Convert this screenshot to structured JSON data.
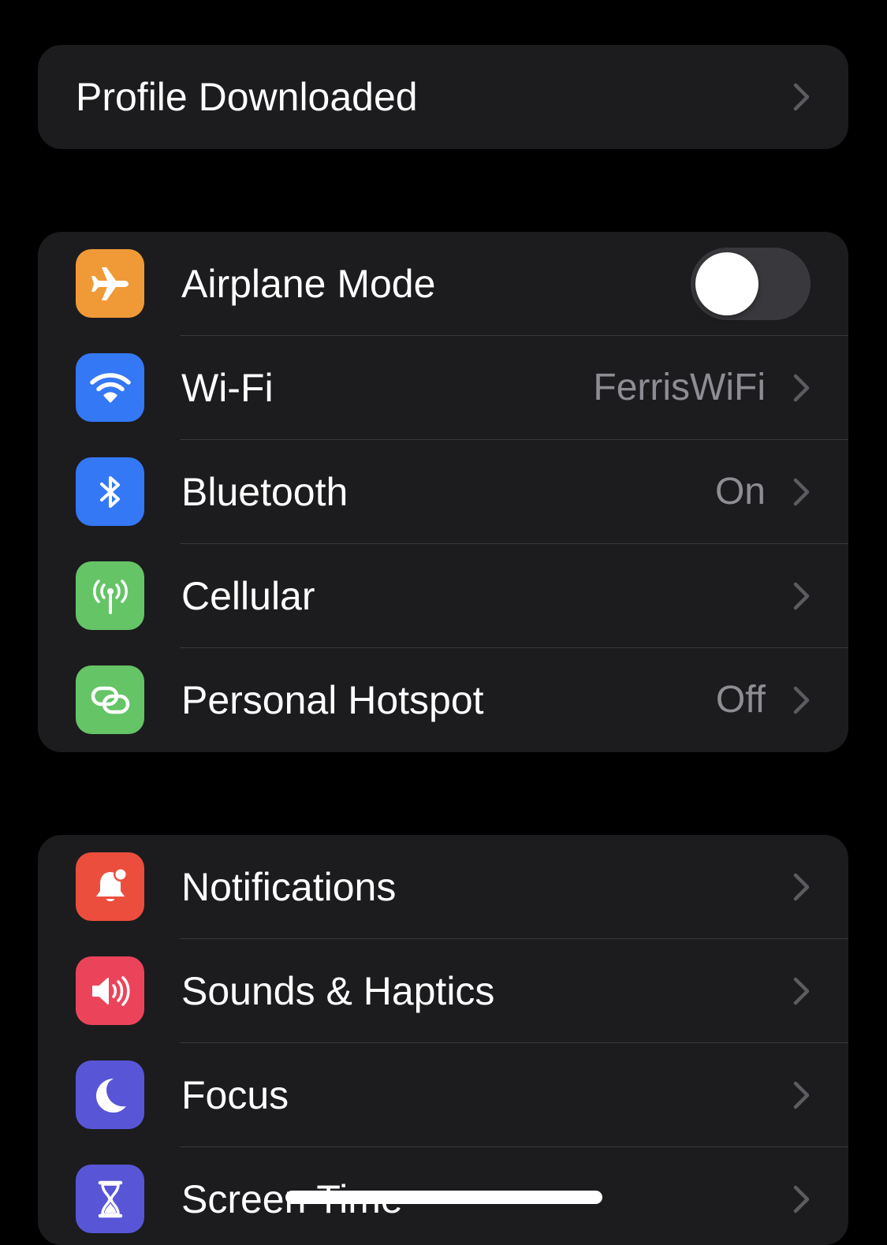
{
  "profile": {
    "label": "Profile Downloaded"
  },
  "connectivity": {
    "airplane": {
      "label": "Airplane Mode",
      "on": false,
      "icon": "airplane-icon",
      "color": "#f09a37"
    },
    "wifi": {
      "label": "Wi-Fi",
      "value": "FerrisWiFi",
      "icon": "wifi-icon",
      "color": "#3478f6"
    },
    "bluetooth": {
      "label": "Bluetooth",
      "value": "On",
      "icon": "bluetooth-icon",
      "color": "#3478f6"
    },
    "cellular": {
      "label": "Cellular",
      "icon": "antenna-icon",
      "color": "#65c466"
    },
    "hotspot": {
      "label": "Personal Hotspot",
      "value": "Off",
      "icon": "link-chain-icon",
      "color": "#65c466"
    }
  },
  "general": {
    "notifications": {
      "label": "Notifications",
      "icon": "bell-badge-icon",
      "color": "#eb4e3d"
    },
    "sounds": {
      "label": "Sounds & Haptics",
      "icon": "speaker-wave-icon",
      "color": "#eb445a"
    },
    "focus": {
      "label": "Focus",
      "icon": "moon-icon",
      "color": "#5856d6"
    },
    "screen_time": {
      "label": "Screen Time",
      "icon": "hourglass-icon",
      "color": "#5856d6"
    }
  }
}
